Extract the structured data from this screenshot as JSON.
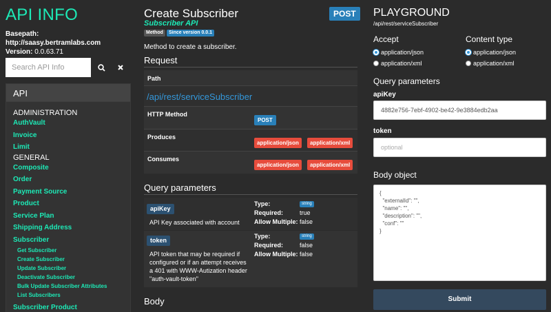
{
  "app": {
    "title": "API INFO",
    "basepath_label": "Basepath:",
    "basepath": "http://saasy.bertramlabs.com",
    "version_label": "Version:",
    "version": "0.0.63.71"
  },
  "search": {
    "placeholder": "Search API Info",
    "search_icon": "search-icon",
    "clear_icon": "close-icon"
  },
  "nav": {
    "header": "API",
    "sections": [
      {
        "title": "ADMINISTRATION",
        "items": [
          "AuthVault",
          "Invoice",
          "Limit"
        ]
      },
      {
        "title": "GENERAL",
        "items": [
          "Composite",
          "Order",
          "Payment Source",
          "Product",
          "Service Plan",
          "Shipping Address",
          "Subscriber"
        ]
      }
    ],
    "subscriber_subitems": [
      "Get Subscriber",
      "Create Subscriber",
      "Update Subscriber",
      "Deactivate Subscriber",
      "Bulk Update Subscriber Attributes",
      "List Subscribers"
    ],
    "trailing_item": "Subscriber Product"
  },
  "endpoint": {
    "title": "Create Subscriber",
    "subtitle": "Subscriber API",
    "method_tag": "Method",
    "since_tag": "Since version 0.0.1",
    "method_badge": "POST",
    "description": "Method to create a subscriber."
  },
  "request": {
    "heading": "Request",
    "path_label": "Path",
    "path": "/api/rest/serviceSubscriber",
    "http_method_label": "HTTP Method",
    "http_method": "POST",
    "produces_label": "Produces",
    "produces": [
      "application/json",
      "application/xml"
    ],
    "consumes_label": "Consumes",
    "consumes": [
      "application/json",
      "application/xml"
    ]
  },
  "query": {
    "heading": "Query parameters",
    "type_label": "Type:",
    "required_label": "Required:",
    "allow_multiple_label": "Allow Multiple:",
    "params": [
      {
        "name": "apiKey",
        "description": "API Key associated with account",
        "type": "string",
        "required": "true",
        "allow_multiple": "false"
      },
      {
        "name": "token",
        "description": "API token that may be required if configured or if an attempt receives a 401 with WWW-Autization header \"auth-vault-token\"",
        "type": "string",
        "required": "false",
        "allow_multiple": "false"
      }
    ]
  },
  "body_section": {
    "heading": "Body"
  },
  "playground": {
    "title": "PLAYGROUND",
    "path": "/api/rest/serviceSubscriber",
    "accept_label": "Accept",
    "accept_options": [
      "application/json",
      "application/xml"
    ],
    "accept_selected": "application/json",
    "content_type_label": "Content type",
    "content_type_options": [
      "application/json",
      "application/xml"
    ],
    "content_type_selected": "application/json",
    "query_heading": "Query parameters",
    "apikey_label": "apiKey",
    "apikey_value": "4882e756-7ebf-4902-be42-9e3884edb2aa",
    "token_label": "token",
    "token_placeholder": "optional",
    "body_label": "Body object",
    "body_lines": [
      "{",
      "  \"externalId\": \"\",",
      "  \"name\": \"\",",
      "  \"description\": \"\",",
      "  \"conf\": \"\"",
      "}"
    ],
    "submit_label": "Submit"
  },
  "colors": {
    "accent": "#1de9b6",
    "link": "#3498db",
    "post": "#2980b9",
    "mime": "#e74c3c",
    "submit": "#34495e"
  }
}
